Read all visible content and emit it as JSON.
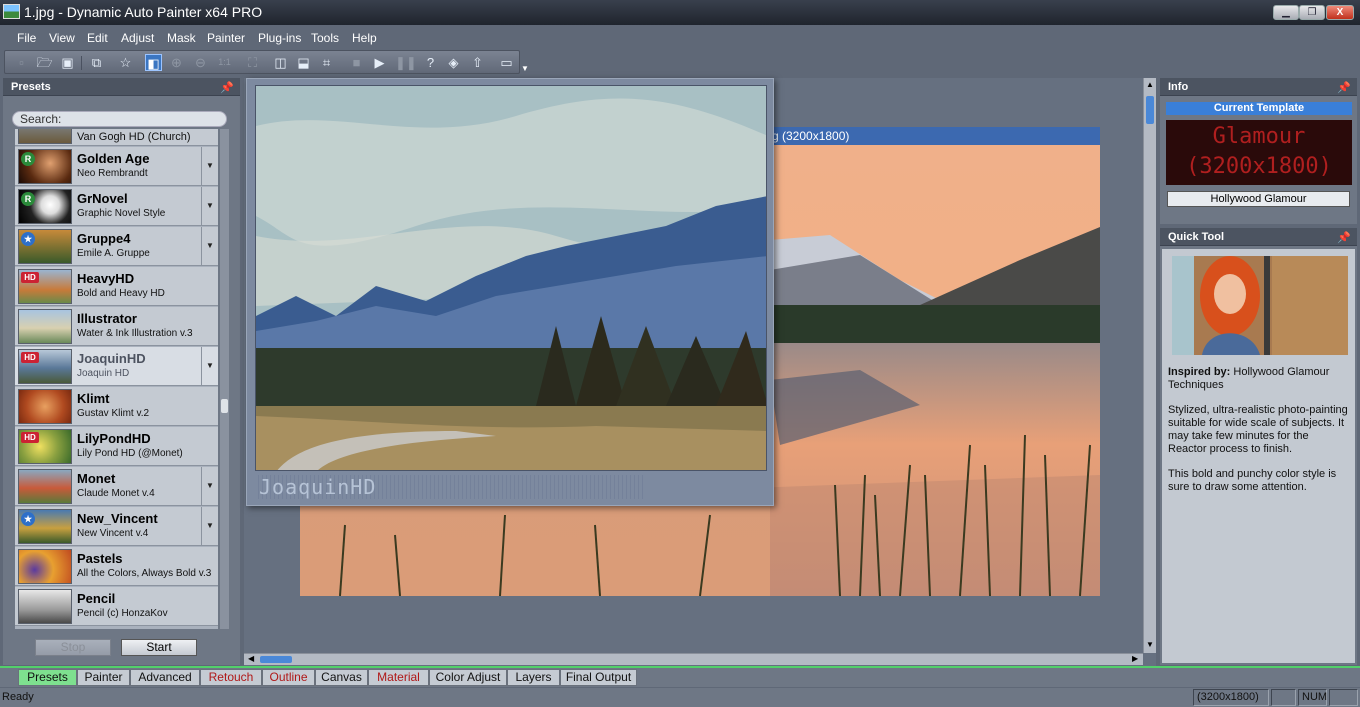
{
  "window": {
    "title": "1.jpg - Dynamic Auto Painter x64 PRO",
    "buttons": {
      "minimize": "▁",
      "restore": "❐",
      "close": "X"
    }
  },
  "menu": [
    "File",
    "View",
    "Edit",
    "Adjust",
    "Mask",
    "Painter",
    "Plug-ins",
    "Tools",
    "Help"
  ],
  "toolbar": {
    "icons": [
      "new-icon",
      "open-icon",
      "save-icon",
      "copy-icon",
      "favorite-icon",
      "compare-icon",
      "zoom-in-icon",
      "zoom-out-icon",
      "zoom-1to1-icon",
      "fit-icon",
      "split-horizontal-icon",
      "split-vertical-icon",
      "crop-icon",
      "stop-icon",
      "play-icon",
      "pause-icon",
      "help-icon",
      "plugin-icon",
      "upload-icon",
      "frame-icon"
    ],
    "zoom_1to1": "1:1"
  },
  "presets": {
    "title": "Presets",
    "search_placeholder": "Search:",
    "items": [
      {
        "name": "",
        "sub": "Van Gogh HD (Church)"
      },
      {
        "name": "Golden Age",
        "sub": "Neo Rembrandt",
        "badge": "R"
      },
      {
        "name": "GrNovel",
        "sub": "Graphic Novel Style",
        "badge": "R"
      },
      {
        "name": "Gruppe4",
        "sub": "Emile A. Gruppe",
        "badge": "★"
      },
      {
        "name": "HeavyHD",
        "sub": "Bold and Heavy HD",
        "badge": "HD"
      },
      {
        "name": "Illustrator",
        "sub": "Water & Ink Illustration v.3"
      },
      {
        "name": "JoaquinHD",
        "sub": "Joaquin HD",
        "badge": "HD"
      },
      {
        "name": "Klimt",
        "sub": "Gustav Klimt v.2"
      },
      {
        "name": "LilyPondHD",
        "sub": "Lily Pond HD (@Monet)",
        "badge": "HD"
      },
      {
        "name": "Monet",
        "sub": "Claude Monet v.4"
      },
      {
        "name": "New_Vincent",
        "sub": "New Vincent v.4",
        "badge": "★"
      },
      {
        "name": "Pastels",
        "sub": "All the Colors, Always Bold v.3"
      },
      {
        "name": "Pencil",
        "sub": "Pencil (c) HonzaKov"
      }
    ],
    "stop_label": "Stop",
    "start_label": "Start"
  },
  "document": {
    "title": "g (3200x1800)"
  },
  "preview": {
    "led_text": "JoaquinHD"
  },
  "info": {
    "title": "Info",
    "current_template_label": "Current Template",
    "led_line1": "Glamour",
    "led_line2": "(3200x1800)",
    "template_name": "Hollywood Glamour"
  },
  "quick_tool": {
    "title": "Quick Tool",
    "inspired_label": "Inspired by:",
    "inspired_value": " Hollywood Glamour Techniques",
    "desc1": "Stylized, ultra-realistic photo-painting suitable for wide scale of subjects. It may take few minutes for the Reactor process to finish.",
    "desc2": "This bold and punchy color style is sure to draw some attention."
  },
  "tabs": [
    "Presets",
    "Painter",
    "Advanced",
    "Retouch",
    "Outline",
    "Canvas",
    "Material",
    "Color Adjust",
    "Layers",
    "Final Output"
  ],
  "status": {
    "ready": "Ready",
    "size": "(3200x1800)",
    "num": "NUM"
  },
  "colors": {
    "accent": "#3b76c2",
    "active_tab": "#7ee08f",
    "led_red": "#b01f1f"
  }
}
